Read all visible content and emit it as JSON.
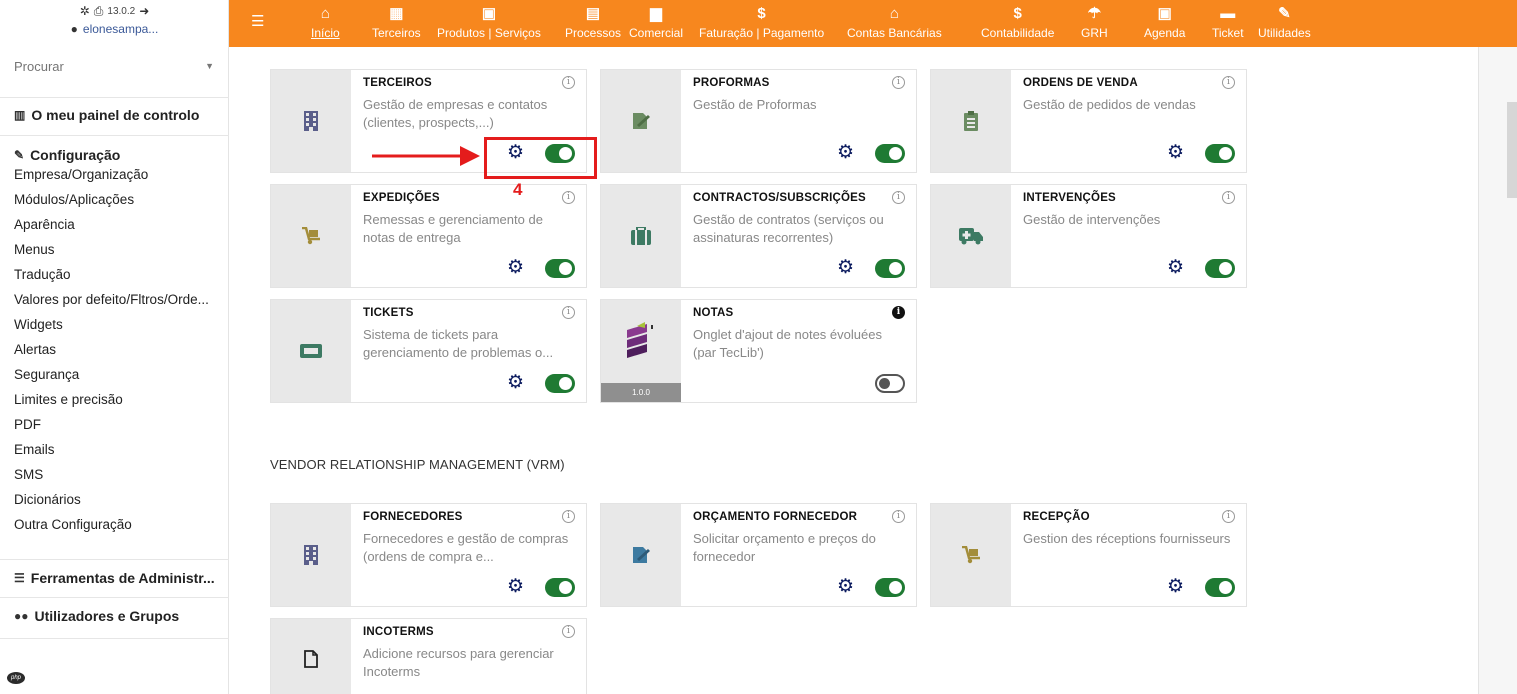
{
  "sidebar": {
    "version": "13.0.2",
    "username": "elonesampa...",
    "search_placeholder": "Procurar",
    "dashboard_label": "O meu painel de controlo",
    "config_label": "Configuração",
    "config_items": [
      "Empresa/Organização",
      "Módulos/Aplicações",
      "Aparência",
      "Menus",
      "Tradução",
      "Valores por defeito/Fltros/Orde...",
      "Widgets",
      "Alertas",
      "Segurança",
      "Limites e precisão",
      "PDF",
      "Emails",
      "SMS",
      "Dicionários",
      "Outra Configuração"
    ],
    "admin_tools_label": "Ferramentas de Administr...",
    "users_groups_label": "Utilizadores e Grupos",
    "php_label": "php"
  },
  "topnav": {
    "items": [
      {
        "label": "Início",
        "icon": "home-icon",
        "glyph": "⌂"
      },
      {
        "label": "Terceiros",
        "icon": "building-icon",
        "glyph": "▦"
      },
      {
        "label": "Produtos | Serviços",
        "icon": "cube-icon",
        "glyph": "▣"
      },
      {
        "label": "Processos",
        "icon": "clipboard-icon",
        "glyph": "▤"
      },
      {
        "label": "Comercial",
        "icon": "suitcase-icon",
        "glyph": "▆"
      },
      {
        "label": "Faturação | Pagamento",
        "icon": "dollar-icon",
        "glyph": "$"
      },
      {
        "label": "Contas Bancárias",
        "icon": "bank-icon",
        "glyph": "⌂"
      },
      {
        "label": "Contabilidade",
        "icon": "dollar-icon",
        "glyph": "$"
      },
      {
        "label": "GRH",
        "icon": "umbrella-icon",
        "glyph": "☂"
      },
      {
        "label": "Agenda",
        "icon": "calendar-icon",
        "glyph": "▣"
      },
      {
        "label": "Ticket",
        "icon": "ticket-icon",
        "glyph": "▬"
      },
      {
        "label": "Utilidades",
        "icon": "wrench-icon",
        "glyph": "✎"
      }
    ]
  },
  "modules": [
    {
      "title": "TERCEIROS",
      "desc": "Gestão de empresas e contatos (clientes, prospects,...)",
      "icon": "building-icon",
      "enabled": true
    },
    {
      "title": "PROFORMAS",
      "desc": "Gestão de Proformas",
      "icon": "proposal-icon",
      "enabled": true
    },
    {
      "title": "ORDENS DE VENDA",
      "desc": "Gestão de pedidos de vendas",
      "icon": "order-icon",
      "enabled": true
    },
    {
      "title": "EXPEDIÇÕES",
      "desc": "Remessas e gerenciamento de notas de entrega",
      "icon": "dolly-icon",
      "enabled": true
    },
    {
      "title": "CONTRACTOS/SUBSCRIÇÕES",
      "desc": "Gestão de contratos (serviços ou assinaturas recorrentes)",
      "icon": "suitcase-icon",
      "enabled": true
    },
    {
      "title": "INTERVENÇÕES",
      "desc": "Gestão de intervenções",
      "icon": "ambulance-icon",
      "enabled": true
    },
    {
      "title": "TICKETS",
      "desc": "Sistema de tickets para gerenciamento de problemas o...",
      "icon": "ticket-icon",
      "enabled": true
    },
    {
      "title": "NOTAS",
      "desc": "Onglet d'ajout de notes évoluées (par TecLib')",
      "icon": "notes-logo-icon",
      "enabled": false,
      "version": "1.0.0"
    }
  ],
  "section_vrm": "VENDOR RELATIONSHIP MANAGEMENT (VRM)",
  "vrm_modules": [
    {
      "title": "FORNECEDORES",
      "desc": "Fornecedores e gestão de compras (ordens de compra e...",
      "icon": "building-icon",
      "enabled": true
    },
    {
      "title": "ORÇAMENTO FORNECEDOR",
      "desc": "Solicitar orçamento e preços do fornecedor",
      "icon": "proposal-icon",
      "enabled": true
    },
    {
      "title": "RECEPÇÃO",
      "desc": "Gestion des réceptions fournisseurs",
      "icon": "dolly-icon",
      "enabled": true
    },
    {
      "title": "INCOTERMS",
      "desc": "Adicione recursos para gerenciar Incoterms",
      "icon": "file-icon",
      "enabled": true
    }
  ],
  "annotation": {
    "number": "4"
  },
  "colors": {
    "topbar": "#f7871e",
    "toggle_on": "#1f7a33",
    "gear": "#0b1a5e",
    "annotation": "#e41c1c"
  }
}
